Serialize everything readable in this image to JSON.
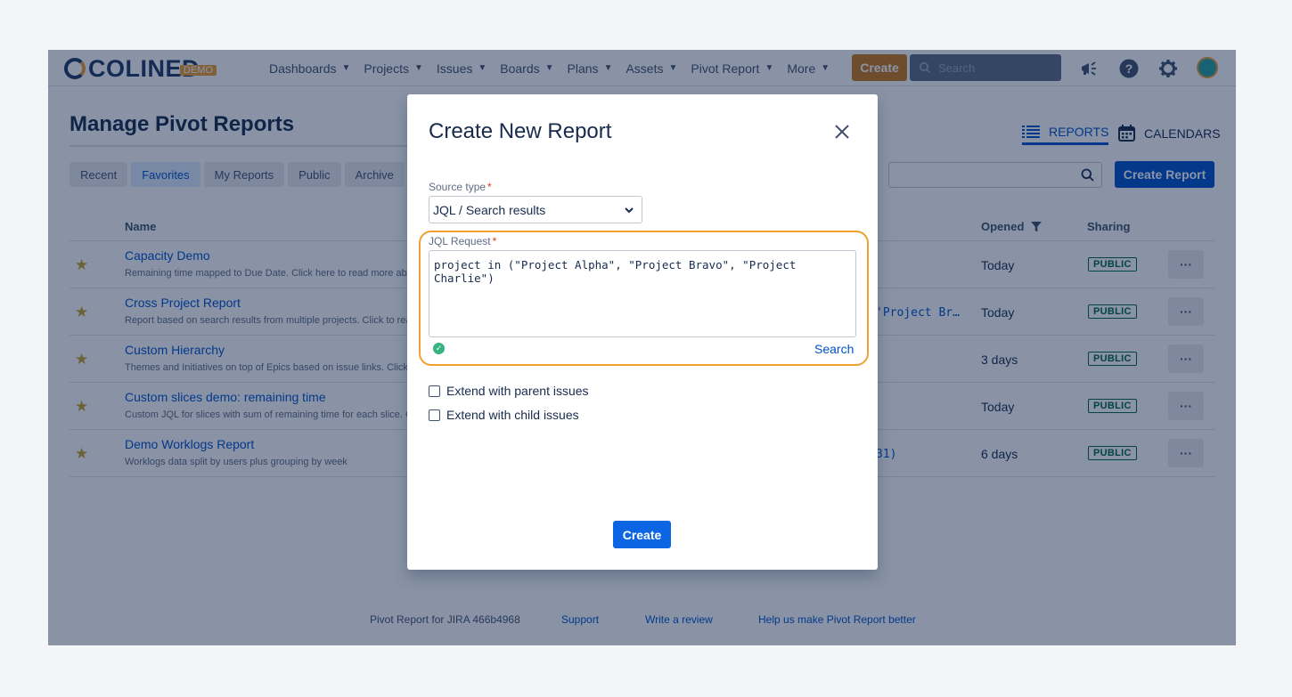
{
  "topnav": {
    "logo_text": "COLINED",
    "logo_badge": "DEMO",
    "items": [
      {
        "label": "Dashboards"
      },
      {
        "label": "Projects"
      },
      {
        "label": "Issues"
      },
      {
        "label": "Boards"
      },
      {
        "label": "Plans"
      },
      {
        "label": "Assets"
      },
      {
        "label": "Pivot Report"
      },
      {
        "label": "More"
      }
    ],
    "create_label": "Create",
    "search_placeholder": "Search",
    "icons": [
      "megaphone-icon",
      "help-icon",
      "gear-icon",
      "avatar"
    ]
  },
  "page": {
    "title": "Manage Pivot Reports",
    "view_tabs": {
      "reports": "REPORTS",
      "calendars": "CALENDARS"
    },
    "filter_tabs": [
      {
        "label": "Recent"
      },
      {
        "label": "Favorites"
      },
      {
        "label": "My Reports"
      },
      {
        "label": "Public"
      },
      {
        "label": "Archive"
      }
    ],
    "create_report_label": "Create Report"
  },
  "table": {
    "headers": {
      "name": "Name",
      "opened": "Opened",
      "sharing": "Sharing"
    },
    "rows": [
      {
        "name": "Capacity Demo",
        "desc": "Remaining time mapped to Due Date. Click here to read more ab",
        "source": "",
        "opened": "Today",
        "sharing": "PUBLIC"
      },
      {
        "name": "Cross Project Report",
        "desc": "Report based on search results from multiple projects. Click to rea",
        "source": "'Project Br…",
        "opened": "Today",
        "sharing": "PUBLIC"
      },
      {
        "name": "Custom Hierarchy",
        "desc": "Themes and Initiatives on top of Epics based on issue links. Click t",
        "source": "",
        "opened": "3 days",
        "sharing": "PUBLIC"
      },
      {
        "name": "Custom slices demo: remaining time",
        "desc": "Custom JQL for slices with sum of remaining time for each slice. C",
        "source": "",
        "opened": "Today",
        "sharing": "PUBLIC"
      },
      {
        "name": "Demo Worklogs Report",
        "desc": "Worklogs data split by users plus grouping by week",
        "source": "31)",
        "opened": "6 days",
        "sharing": "PUBLIC"
      }
    ],
    "more_label": "···"
  },
  "footer": {
    "version": "Pivot Report for JIRA 466b4968",
    "support": "Support",
    "review": "Write a review",
    "better": "Help us make Pivot Report better"
  },
  "modal": {
    "title": "Create New Report",
    "source_type_label": "Source type",
    "source_type_value": "JQL / Search results",
    "jql_label": "JQL Request",
    "jql_value": "project in (\"Project Alpha\", \"Project Bravo\", \"Project Charlie\")",
    "search_label": "Search",
    "extend_parent_label": "Extend with parent issues",
    "extend_child_label": "Extend with child issues",
    "create_label": "Create",
    "required_mark": "*"
  },
  "colors": {
    "primary": "#0052cc",
    "accent": "#f0a030",
    "success": "#36b37e",
    "overlay": "rgba(9,30,66,0.48)"
  }
}
